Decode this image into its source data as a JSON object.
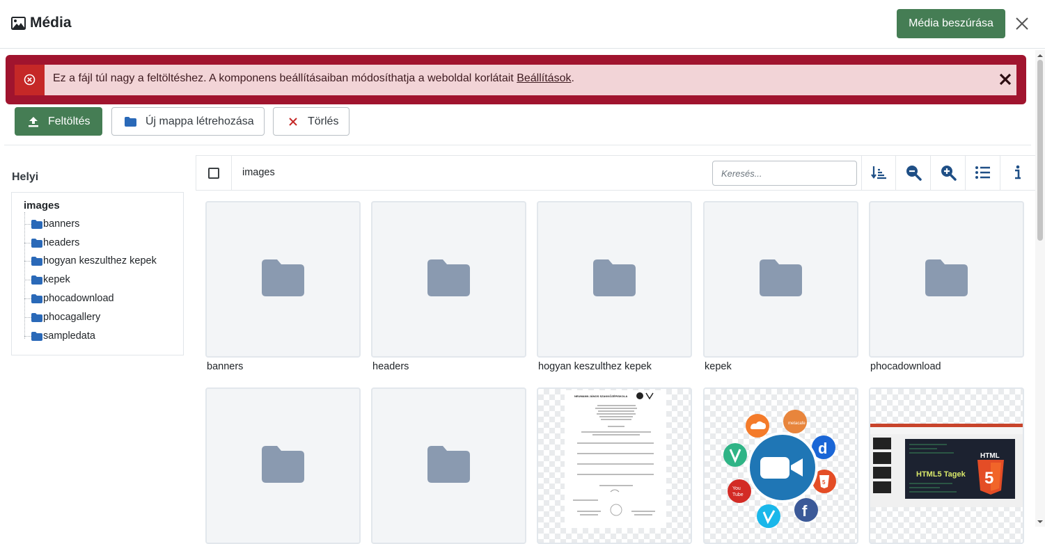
{
  "header": {
    "title": "Média",
    "insert_label": "Média beszúrása"
  },
  "alert": {
    "message": "Ez a fájl túl nagy a feltöltéshez. A komponens beállításaiban módosíthatja a weboldal korlátait",
    "link_label": "Beállítások",
    "trailing": "."
  },
  "toolbar": {
    "upload_label": "Feltöltés",
    "new_folder_label": "Új mappa létrehozása",
    "delete_label": "Törlés"
  },
  "sidebar": {
    "title": "Helyi",
    "root": "images",
    "folders": [
      "banners",
      "headers",
      "hogyan keszulthez kepek",
      "kepek",
      "phocadownload",
      "phocagallery",
      "sampledata"
    ]
  },
  "browser": {
    "path": "images",
    "search_placeholder": "Keresés...",
    "tools": [
      "sort-icon",
      "zoom-out-icon",
      "zoom-in-icon",
      "list-view-icon",
      "info-icon"
    ]
  },
  "grid": {
    "row1_labels": [
      "banners",
      "headers",
      "hogyan keszulthez kepek",
      "kepek",
      "phocadownload"
    ]
  },
  "thumbnails": {
    "cert_header": "NEUMANN JÁNOS SZAKKÖZÉPISKOLA",
    "html_title": "HTML5 Tagek",
    "html_badge": "HTML"
  },
  "colors": {
    "primary": "#457d54",
    "alert_dark": "#a0142e",
    "alert_bg": "#f2d4d7",
    "folder": "#2a69b8",
    "folder_placeholder": "#8a9ab0",
    "tool_icon": "#1f4f86"
  }
}
